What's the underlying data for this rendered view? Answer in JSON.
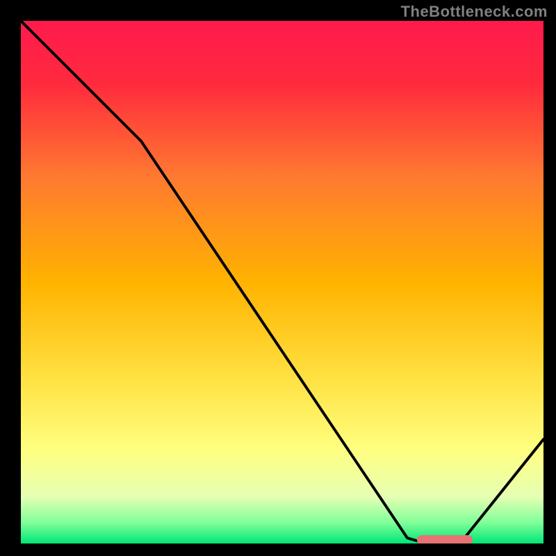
{
  "watermark": "TheBottleneck.com",
  "chart_data": {
    "type": "line",
    "title": "",
    "xlabel": "",
    "ylabel": "",
    "xlim": [
      0,
      100
    ],
    "ylim": [
      0,
      100
    ],
    "x": [
      0,
      23,
      74,
      80,
      84,
      100
    ],
    "values": [
      100,
      77,
      1,
      0,
      0,
      20
    ],
    "optimal_range_x": [
      78,
      86
    ],
    "gradient_stops": [
      {
        "pos": 0,
        "color": "#ff1744"
      },
      {
        "pos": 0.5,
        "color": "#ffb300"
      },
      {
        "pos": 0.78,
        "color": "#ffff66"
      },
      {
        "pos": 0.92,
        "color": "#dfffb0"
      },
      {
        "pos": 0.98,
        "color": "#00e676"
      },
      {
        "pos": 1.0,
        "color": "#00e676"
      }
    ],
    "marker_color": "#e57373",
    "line_color": "#000000"
  }
}
